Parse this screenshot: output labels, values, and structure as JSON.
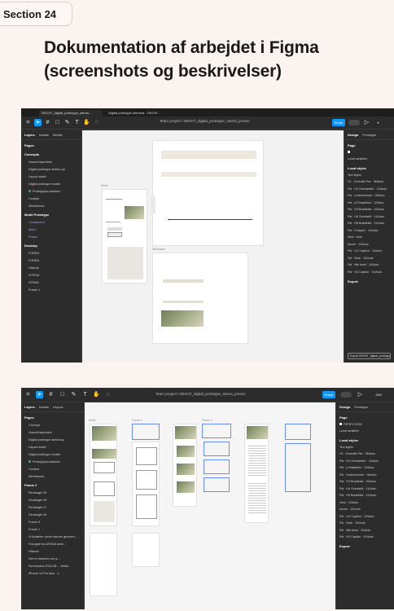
{
  "section": {
    "label": "Section 24"
  },
  "heading": {
    "line1": "Dokumentation af arbejdet i Figma",
    "line2": "(screenshots og beskrivelser)"
  },
  "shot1": {
    "tabs": [
      {
        "label": "DEGIIT_digital_prototype_stema...",
        "active": true
      },
      {
        "label": "Digital prototype stemma - DEGIIT...",
        "active": false
      }
    ],
    "breadcrumb": "Team project  /  DEGIIT_digital_prototype_stema_jensen",
    "share_label": "Share",
    "left_tabs": [
      "Layers",
      "Assets",
      "Mobile"
    ],
    "pages_label": "Pages",
    "layers": [
      {
        "label": "Concepts",
        "style": "head"
      },
      {
        "label": "Vision/Inspiration",
        "style": "plain"
      },
      {
        "label": "Digital prototype sketch-up",
        "style": "plain"
      },
      {
        "label": "Layout skabt",
        "style": "plain"
      },
      {
        "label": "Digital prototype model",
        "style": "plain"
      },
      {
        "label": "Prototypeproduktion",
        "style": "green"
      },
      {
        "label": "Contact",
        "style": "plain"
      },
      {
        "label": "Wireframes",
        "style": "plain"
      },
      {
        "label": "Mobil Prototype",
        "style": "head"
      },
      {
        "label": "Component",
        "style": "purple"
      },
      {
        "label": "Menu",
        "style": "purple"
      },
      {
        "label": "Footer",
        "style": "purple"
      },
      {
        "label": "Desktop",
        "style": "head"
      },
      {
        "label": "FOREN",
        "style": "plain"
      },
      {
        "label": "FOREN",
        "style": "plain"
      },
      {
        "label": "Historie",
        "style": "plain"
      },
      {
        "label": "STEDM",
        "style": "plain"
      },
      {
        "label": "ATEMA",
        "style": "plain"
      },
      {
        "label": "Frame 1",
        "style": "plain"
      }
    ],
    "right_tabs": [
      "Design",
      "Prototype"
    ],
    "right_sections": {
      "page": "Page",
      "local_variables": "Local variables",
      "local_styles": "Local styles",
      "text_styles": "Text styles",
      "export": "Export"
    },
    "right_items": [
      "H1 · Granville Par · 36/Auto",
      "Pal · H2 Overskrifter · 24/Auto",
      "Pal · Underoverskr · 18/Auto",
      "Pal · p3 Brødtekst · 12/Auto",
      "Pal · H3 Brødtekst · 16/Auto",
      "Pal · H4 Overskrift · 14/Auto",
      "Pal · H5 Brødtekst · 12/Auto",
      "Pal · Knapper · 12/Auto",
      "Hent · Auto",
      "Ikoner · 12/Auto",
      "Pal · UX Caption · 10/Auto",
      "Pal · Note · 10/Auto",
      "Pal · Alle tekst · 10/Auto",
      "Pal · H2 Caption · 10/Auto"
    ],
    "export_button": "Export DEGIIT_digital_prototype..."
  },
  "shot2": {
    "breadcrumb": "Team project  /  DEGIIT_digital_prototype_stema_jensen",
    "share_label": "Share",
    "left_tabs": [
      "Layers",
      "Assets",
      "Layout..."
    ],
    "pages_label": "Pages",
    "layers": [
      {
        "label": "Concept",
        "style": "plain"
      },
      {
        "label": "Vision/Inspiration",
        "style": "plain"
      },
      {
        "label": "Digital prototype sketchup",
        "style": "plain"
      },
      {
        "label": "Layout skabt",
        "style": "plain"
      },
      {
        "label": "Digital prototype model",
        "style": "plain"
      },
      {
        "label": "Prototypeproduktion",
        "style": "green"
      },
      {
        "label": "Contact",
        "style": "plain"
      },
      {
        "label": "Wireframes",
        "style": "plain"
      },
      {
        "label": "Frame 2",
        "style": "head"
      },
      {
        "label": "Rectangle 25",
        "style": "plain"
      },
      {
        "label": "Rectangle 28",
        "style": "plain"
      },
      {
        "label": "Rectangle 27",
        "style": "plain"
      },
      {
        "label": "Rectangle 26",
        "style": "plain"
      },
      {
        "label": "Frame 3",
        "style": "plain"
      },
      {
        "label": "Frame 1",
        "style": "plain"
      },
      {
        "label": "Vi fortæller vores historie gennem...",
        "style": "plain"
      },
      {
        "label": "Fotografi fra ATEMA arkiv...",
        "style": "plain"
      },
      {
        "label": "Historie",
        "style": "plain"
      },
      {
        "label": "Det er historien om ø...",
        "style": "plain"
      },
      {
        "label": "Screenshot 2024-08-... Mobil...",
        "style": "plain"
      },
      {
        "label": "iPhone 14 Pro Max - 1",
        "style": "plain"
      }
    ],
    "right_tabs": [
      "Design",
      "Prototype"
    ],
    "right_sections": {
      "page": "Page",
      "local_variables": "Local variables",
      "local_styles": "Local styles",
      "text_styles": "Text styles",
      "export": "Export"
    },
    "color_value": "F5F5F5",
    "color_opacity": "100%",
    "right_items": [
      "H1 · Granville Par · 36/Auto",
      "Pal · H2 Overskrifter · 24/Auto",
      "Pal · p Brødtekst · 12/Auto",
      "Pal · Underoverskr · 18/Auto",
      "Pal · H3 Brødtekst · 16/Auto",
      "Pal · H4 Overskrift · 14/Auto",
      "Pal · H5 Brødtekst · 12/Auto",
      "Hent · 12/Auto",
      "Ikoner · 12/Auto",
      "Pal · UX Caption · 10/Auto",
      "Pal · Note · 10/Auto",
      "Pal · Alle tekst · 10/Auto",
      "Pal · H2 Caption · 10/Auto"
    ],
    "zoom": "15%"
  }
}
